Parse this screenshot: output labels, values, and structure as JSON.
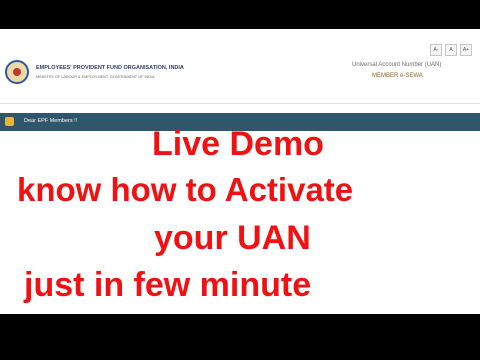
{
  "header": {
    "org_name": "EMPLOYEES' PROVIDENT FUND ORGANISATION, INDIA",
    "ministry": "MINISTRY OF LABOUR & EMPLOYMENT, GOVERNMENT OF INDIA",
    "uan_title": "Universal Account Number (UAN)",
    "member_label": "MEMBER e-SEWA",
    "font_controls": [
      "A-",
      "A",
      "A+"
    ]
  },
  "notice_bar": {
    "text": "Dear EPF Members !!"
  },
  "overlay": {
    "line1": "Live Demo",
    "line2": "know how to Activate",
    "line3": "your UAN",
    "line4": "just in few minute"
  },
  "colors": {
    "overlay_text": "#f01212",
    "notice_bar": "#30566b",
    "letterbox": "#000000"
  }
}
